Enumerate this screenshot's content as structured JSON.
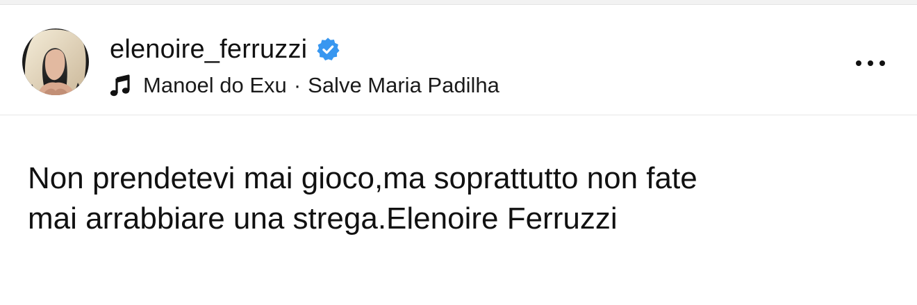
{
  "post": {
    "author": {
      "username": "elenoire_ferruzzi",
      "verified_icon": "verified-badge-icon",
      "verified_color": "#3897f0",
      "avatar_icon": "profile-avatar"
    },
    "music": {
      "icon": "music-note-icon",
      "artist": "Manoel do Exu",
      "separator": "·",
      "track": "Salve Maria Padilha"
    },
    "more_icon": "more-options-icon",
    "caption": "Non prendetevi mai gioco,ma soprattutto non fate\nmai arrabbiare una strega.Elenoire Ferruzzi"
  }
}
